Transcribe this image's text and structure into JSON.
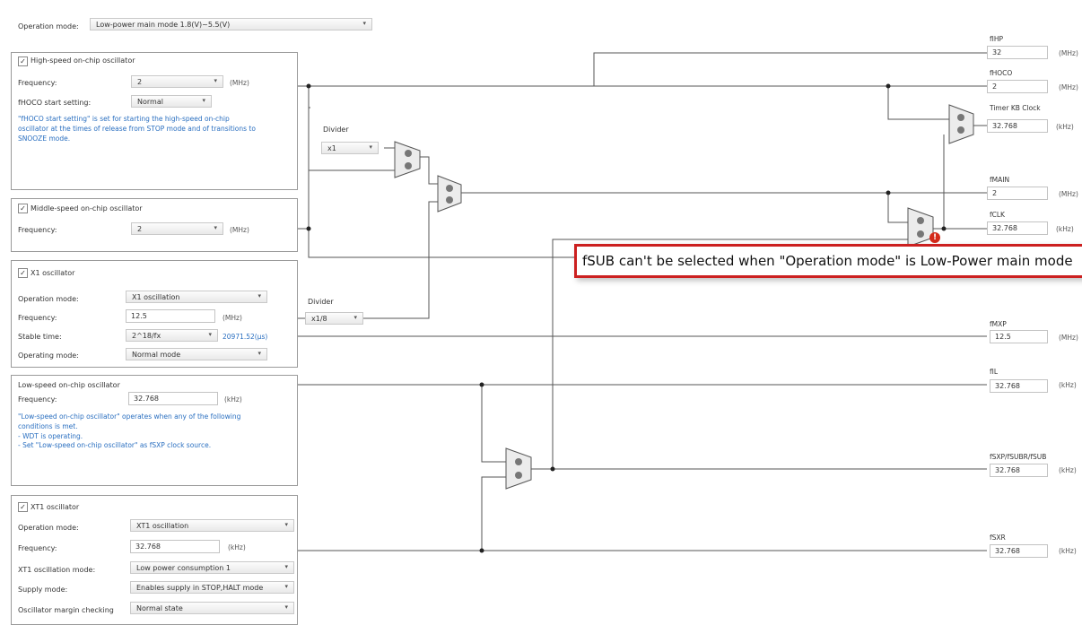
{
  "operation_mode": {
    "label": "Operation mode:",
    "value": "Low-power main mode 1.8(V)~5.5(V)"
  },
  "hoco": {
    "title": "High-speed on-chip oscillator",
    "checked": true,
    "freq_label": "Frequency:",
    "freq_value": "2",
    "freq_unit": "(MHz)",
    "start_label": "fHOCO start setting:",
    "start_value": "Normal",
    "note": "\"fHOCO start setting\" is set for starting the high-speed on-chip oscillator at the times of release from STOP mode and of transitions to SNOOZE mode."
  },
  "moco": {
    "title": "Middle-speed on-chip oscillator",
    "checked": true,
    "freq_label": "Frequency:",
    "freq_value": "2",
    "freq_unit": "(MHz)"
  },
  "x1": {
    "title": "X1 oscillator",
    "checked": true,
    "mode_label": "Operation mode:",
    "mode_value": "X1 oscillation",
    "freq_label": "Frequency:",
    "freq_value": "12.5",
    "freq_unit": "(MHz)",
    "stable_label": "Stable time:",
    "stable_value": "2^18/fx",
    "stable_time": "20971.52(μs)",
    "opmode_label": "Operating mode:",
    "opmode_value": "Normal mode"
  },
  "loco": {
    "title": "Low-speed on-chip oscillator",
    "freq_label": "Frequency:",
    "freq_value": "32.768",
    "freq_unit": "(kHz)",
    "note_1": "\"Low-speed on-chip oscillator\" operates when any of the following conditions is met.",
    "note_2": "- WDT is operating.",
    "note_3": "- Set \"Low-speed on-chip oscillator\" as fSXP clock source."
  },
  "xt1": {
    "title": "XT1 oscillator",
    "checked": true,
    "mode_label": "Operation mode:",
    "mode_value": "XT1 oscillation",
    "freq_label": "Frequency:",
    "freq_value": "32.768",
    "freq_unit": "(kHz)",
    "osc_label": "XT1 oscillation mode:",
    "osc_value": "Low power consumption 1",
    "supply_label": "Supply mode:",
    "supply_value": "Enables supply in STOP,HALT mode",
    "margin_label": "Oscillator margin checking",
    "margin_value": "Normal state"
  },
  "divider1": {
    "label": "Divider",
    "value": "x1"
  },
  "divider2": {
    "label": "Divider",
    "value": "x1/8"
  },
  "outputs": {
    "fihp": {
      "label": "fIHP",
      "value": "32",
      "unit": "(MHz)"
    },
    "fhoco": {
      "label": "fHOCO",
      "value": "2",
      "unit": "(MHz)"
    },
    "timerkb": {
      "label": "Timer KB Clock",
      "value": "32.768",
      "unit": "(kHz)"
    },
    "fmain": {
      "label": "fMAIN",
      "value": "2",
      "unit": "(MHz)"
    },
    "fclk": {
      "label": "fCLK",
      "value": "32.768",
      "unit": "(kHz)"
    },
    "fmxp": {
      "label": "fMXP",
      "value": "12.5",
      "unit": "(MHz)"
    },
    "fil": {
      "label": "fIL",
      "value": "32.768",
      "unit": "(kHz)"
    },
    "fsxp": {
      "label": "fSXP/fSUBR/fSUB",
      "value": "32.768",
      "unit": "(kHz)"
    },
    "fsxr": {
      "label": "fSXR",
      "value": "32.768",
      "unit": "(kHz)"
    }
  },
  "tooltip": {
    "text": "fSUB can't be selected when \"Operation mode\" is Low-Power main mode"
  },
  "icons": {
    "check": "✓",
    "dropdown": "▾",
    "error": "!"
  },
  "colors": {
    "tooltip_border": "#cc2020",
    "error": "#d42a1a",
    "note": "#2a6fc0"
  }
}
